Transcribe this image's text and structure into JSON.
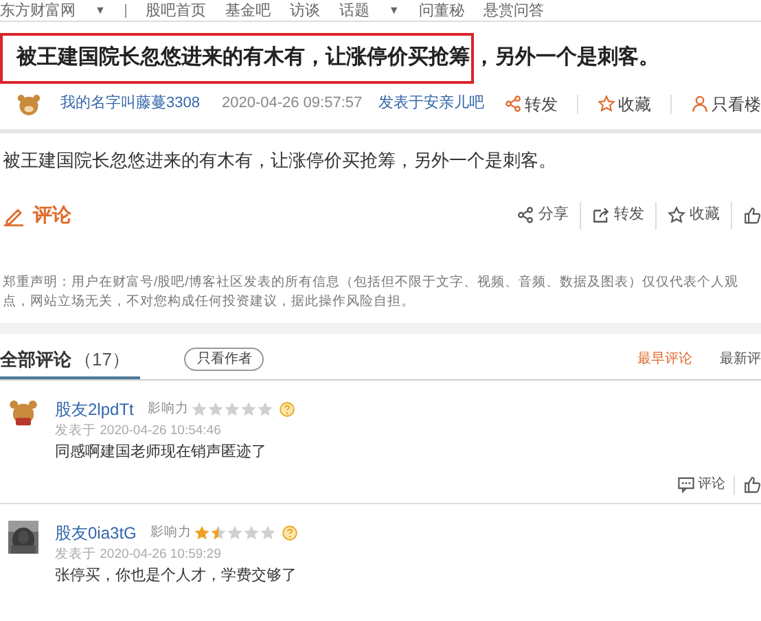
{
  "nav": [
    {
      "label": "东方财富网",
      "caret": "▼"
    },
    {
      "label": "股吧首页"
    },
    {
      "label": "基金吧"
    },
    {
      "label": "访谈"
    },
    {
      "label": "话题",
      "caret": "▼"
    },
    {
      "label": "问董秘"
    },
    {
      "label": "悬赏问答"
    }
  ],
  "post": {
    "title_highlighted": "被王建国院长忽悠进来的有木有，让涨停价买抢筹",
    "title_rest": "，另外一个是刺客。",
    "author": "我的名字叫藤蔓3308",
    "time": "2020-04-26 09:57:57",
    "posted_in": "发表于安亲儿吧",
    "actions": [
      {
        "kind": "share",
        "label": "转发"
      },
      {
        "kind": "star",
        "label": "收藏"
      },
      {
        "kind": "person",
        "label": "只看楼"
      }
    ],
    "body": "被王建国院长忽悠进来的有木有，让涨停价买抢筹，另外一个是刺客。",
    "comment_button": "评论",
    "tools": [
      {
        "kind": "share",
        "label": "分享"
      },
      {
        "kind": "forward",
        "label": "转发"
      },
      {
        "kind": "star",
        "label": "收藏"
      },
      {
        "kind": "like"
      }
    ],
    "disclaimer": "郑重声明：用户在财富号/股吧/博客社区发表的所有信息（包括但不限于文字、视频、音频、数据及图表）仅仅代表个人观点，网站立场无关，不对您构成任何投资建议，据此操作风险自担。"
  },
  "comments_header": {
    "tabs": [
      {
        "label": "全部评论",
        "count": "（17）",
        "selected": true
      }
    ],
    "author_only": "只看作者",
    "sorts": [
      {
        "label": "最早评论",
        "selected": true
      },
      {
        "label": "最新评",
        "selected": false
      }
    ]
  },
  "comments": [
    {
      "user": "股友2lpdTt",
      "influence_label": "影响力",
      "stars": 0,
      "time": "发表于 2020-04-26 10:54:46",
      "text": "同感啊建国老师现在销声匿迹了",
      "reply": "评论",
      "kind": "icon"
    },
    {
      "user": "股友0ia3tG",
      "influence_label": "影响力",
      "stars": 1.5,
      "time": "发表于 2020-04-26 10:59:29",
      "text": "张停买，你也是个人才，学费交够了",
      "kind": "picture"
    }
  ]
}
